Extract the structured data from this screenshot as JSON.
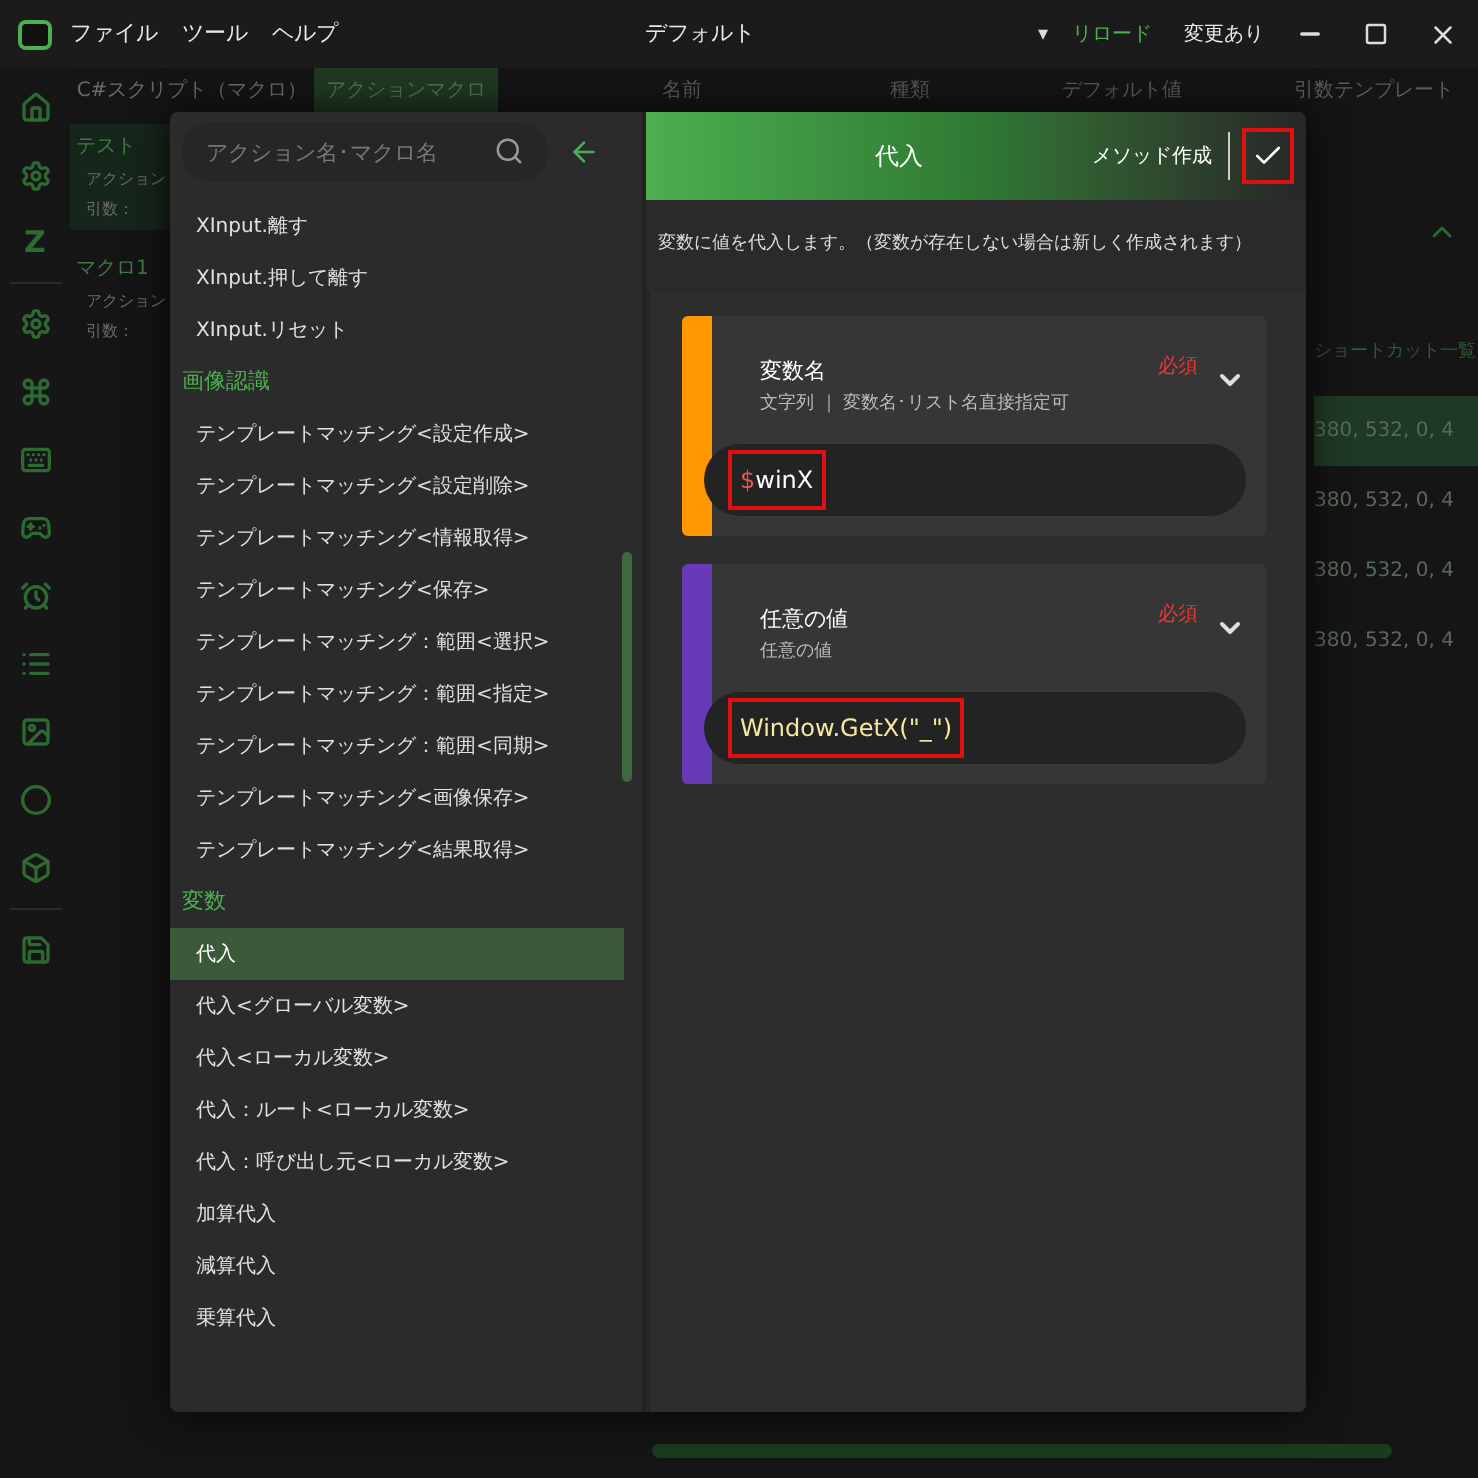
{
  "title_bar": {
    "menu": [
      "ファイル",
      "ツール",
      "ヘルプ"
    ],
    "profile": "デフォルト",
    "dropdown_arrow": "▾",
    "reload": "リロード",
    "status": "変更あり"
  },
  "sidebar": {
    "glyph": "Z"
  },
  "background": {
    "tabs": [
      {
        "label": "C#スクリプト（マクロ）",
        "selected": false
      },
      {
        "label": "アクションマクロ",
        "selected": true
      }
    ],
    "columns": [
      "名前",
      "種類",
      "デフォルト値",
      "引数テンプレート"
    ],
    "macros": [
      {
        "name": "テスト",
        "selected": true,
        "action": "アクション",
        "args": "引数："
      },
      {
        "name": "マクロ1",
        "selected": false,
        "action": "アクション",
        "args": "引数："
      }
    ],
    "shortcuts_heading": "ショートカット一覧",
    "shortcut_rows": [
      {
        "text": "380, 532, 0, 4",
        "selected": true
      },
      {
        "text": "380, 532, 0, 4",
        "selected": false
      },
      {
        "text": "380, 532, 0, 4",
        "selected": false
      },
      {
        "text": "380, 532, 0, 4",
        "selected": false
      }
    ]
  },
  "dialog": {
    "search": {
      "placeholder": "アクション名･マクロ名"
    },
    "list": [
      {
        "kind": "item",
        "label": "XInput.離す",
        "selected": false
      },
      {
        "kind": "item",
        "label": "XInput.押して離す",
        "selected": false
      },
      {
        "kind": "item",
        "label": "XInput.リセット",
        "selected": false
      },
      {
        "kind": "category",
        "label": "画像認識"
      },
      {
        "kind": "item",
        "label": "テンプレートマッチング<設定作成>",
        "selected": false
      },
      {
        "kind": "item",
        "label": "テンプレートマッチング<設定削除>",
        "selected": false
      },
      {
        "kind": "item",
        "label": "テンプレートマッチング<情報取得>",
        "selected": false
      },
      {
        "kind": "item",
        "label": "テンプレートマッチング<保存>",
        "selected": false
      },
      {
        "kind": "item",
        "label": "テンプレートマッチング：範囲<選択>",
        "selected": false
      },
      {
        "kind": "item",
        "label": "テンプレートマッチング：範囲<指定>",
        "selected": false
      },
      {
        "kind": "item",
        "label": "テンプレートマッチング：範囲<同期>",
        "selected": false
      },
      {
        "kind": "item",
        "label": "テンプレートマッチング<画像保存>",
        "selected": false
      },
      {
        "kind": "item",
        "label": "テンプレートマッチング<結果取得>",
        "selected": false
      },
      {
        "kind": "category",
        "label": "変数"
      },
      {
        "kind": "item",
        "label": "代入",
        "selected": true
      },
      {
        "kind": "item",
        "label": "代入<グローバル変数>",
        "selected": false
      },
      {
        "kind": "item",
        "label": "代入<ローカル変数>",
        "selected": false
      },
      {
        "kind": "item",
        "label": "代入：ルート<ローカル変数>",
        "selected": false
      },
      {
        "kind": "item",
        "label": "代入：呼び出し元<ローカル変数>",
        "selected": false
      },
      {
        "kind": "item",
        "label": "加算代入",
        "selected": false
      },
      {
        "kind": "item",
        "label": "減算代入",
        "selected": false
      },
      {
        "kind": "item",
        "label": "乗算代入",
        "selected": false
      }
    ],
    "header": {
      "title": "代入",
      "method_button": "メソッド作成",
      "confirm_highlighted": true
    },
    "description": "変数に値を代入します。（変数が存在しない場合は新しく作成されます）",
    "params": [
      {
        "color": "#ff9800",
        "name": "変数名",
        "type": "文字列 ｜ 変数名･リスト名直接指定可",
        "required": "必須",
        "value": {
          "sigil": "$",
          "text": "winX"
        },
        "highlighted": true
      },
      {
        "color": "#673ab7",
        "name": "任意の値",
        "type": "任意の値",
        "required": "必須",
        "value": {
          "text": "Window.GetX(\"_\")"
        },
        "highlighted": true
      }
    ]
  }
}
